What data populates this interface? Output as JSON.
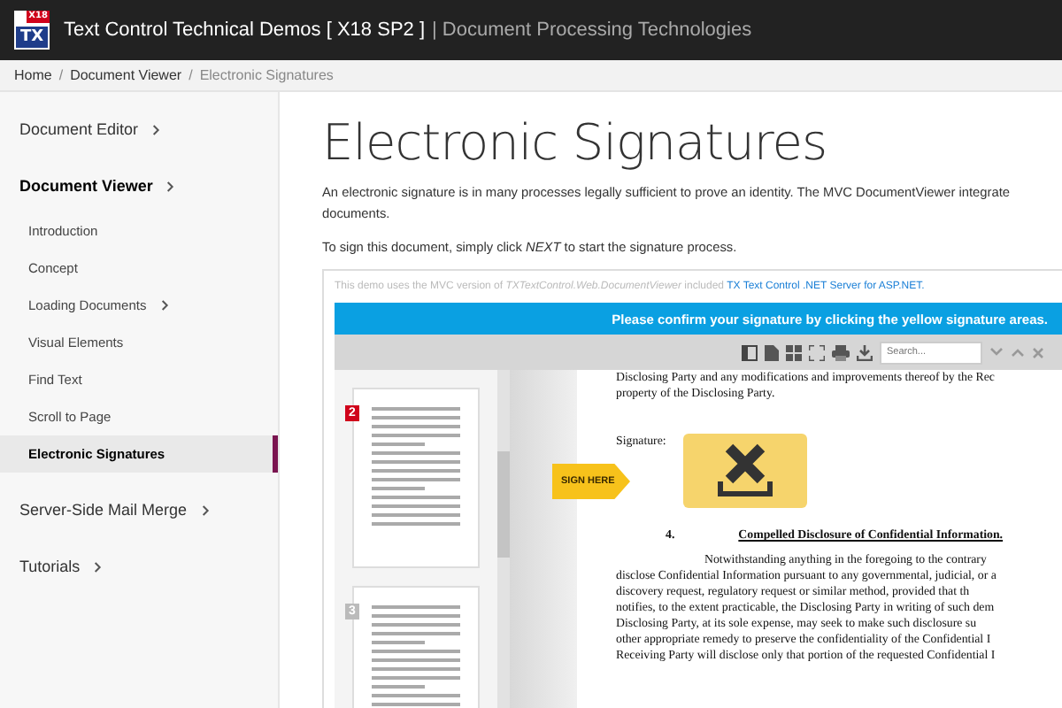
{
  "header": {
    "logo": {
      "badge": "X18",
      "letters": "TX"
    },
    "title": "Text Control Technical Demos [ X18 SP2 ]",
    "subtitle": "| Document Processing Technologies"
  },
  "breadcrumb": {
    "items": [
      {
        "label": "Home",
        "current": false
      },
      {
        "label": "Document Viewer",
        "current": false
      },
      {
        "label": "Electronic Signatures",
        "current": true
      }
    ],
    "separators": [
      "/",
      "/"
    ]
  },
  "sidebar": {
    "items": [
      {
        "label": "Document Editor",
        "expandable": true,
        "active": false
      },
      {
        "label": "Document Viewer",
        "expandable": true,
        "active": true,
        "children": [
          {
            "label": "Introduction",
            "expandable": false,
            "selected": false
          },
          {
            "label": "Concept",
            "expandable": false,
            "selected": false
          },
          {
            "label": "Loading Documents",
            "expandable": true,
            "selected": false
          },
          {
            "label": "Visual Elements",
            "expandable": false,
            "selected": false
          },
          {
            "label": "Find Text",
            "expandable": false,
            "selected": false
          },
          {
            "label": "Scroll to Page",
            "expandable": false,
            "selected": false
          },
          {
            "label": "Electronic Signatures",
            "expandable": false,
            "selected": true
          }
        ]
      },
      {
        "label": "Server-Side Mail Merge",
        "expandable": true,
        "active": false
      },
      {
        "label": "Tutorials",
        "expandable": true,
        "active": false
      }
    ]
  },
  "main": {
    "heading": "Electronic Signatures",
    "intro_lines": [
      "An electronic signature is in many processes legally sufficient to prove an identity. The MVC DocumentViewer integrate",
      "documents."
    ],
    "instruction": "To sign this document, simply click *NEXT* to start the signature process.",
    "demo": {
      "note": "This demo uses the MVC version of *TXTextControl.Web.DocumentViewer* included",
      "note_link": "TX Text Control .NET Server for ASP.NET.",
      "banner": "Please confirm your signature by clicking the yellow signature areas.",
      "search": {
        "placeholder": "Search..."
      },
      "thumbnails": [
        {
          "page": "2",
          "selected": true
        },
        {
          "page": "3",
          "selected": false
        }
      ],
      "sign_flag": "SIGN HERE",
      "document": {
        "top_lines": [
          "Disclosing Party and any modifications and improvements thereof by the Rec",
          "property of the Disclosing Party."
        ],
        "signature_label": "Signature:",
        "section_number": "4.",
        "section_title": "Compelled Disclosure of Confidential Information.",
        "paragraph_lines": [
          "Notwithstanding anything in the foregoing to the contrary",
          "disclose Confidential Information pursuant to any governmental, judicial, or a",
          "discovery request, regulatory request or similar method, provided that th",
          "notifies, to the extent practicable, the Disclosing Party in writing of such dem",
          "Disclosing Party, at its sole expense, may seek to make such disclosure su",
          "other appropriate remedy to preserve the confidentiality of the Confidential I",
          "Receiving Party will disclose only that portion of the requested Confidential I"
        ]
      }
    }
  }
}
